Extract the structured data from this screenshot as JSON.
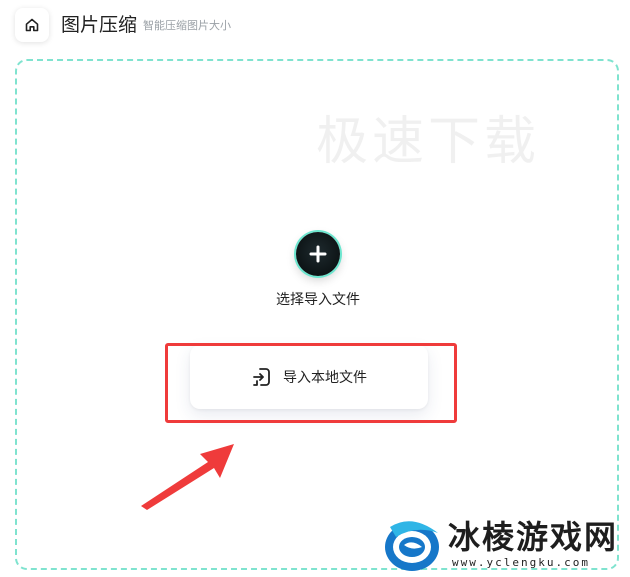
{
  "header": {
    "title": "图片压缩",
    "subtitle": "智能压缩图片大小"
  },
  "watermark": {
    "top_text": "极速下载",
    "site_name": "冰棱游戏网",
    "site_url": "www.yclengku.com"
  },
  "upload": {
    "select_label": "选择导入文件",
    "import_label": "导入本地文件"
  },
  "colors": {
    "dropzone_border": "#7fe3cf",
    "highlight": "#ef3b3b",
    "plus_ring": "#6de6cf",
    "logo_blue": "#1677c9"
  },
  "icons": {
    "home": "home-icon",
    "plus": "plus-icon",
    "import": "import-file-icon",
    "arrow": "arrow-annotation",
    "logo": "site-logo"
  }
}
